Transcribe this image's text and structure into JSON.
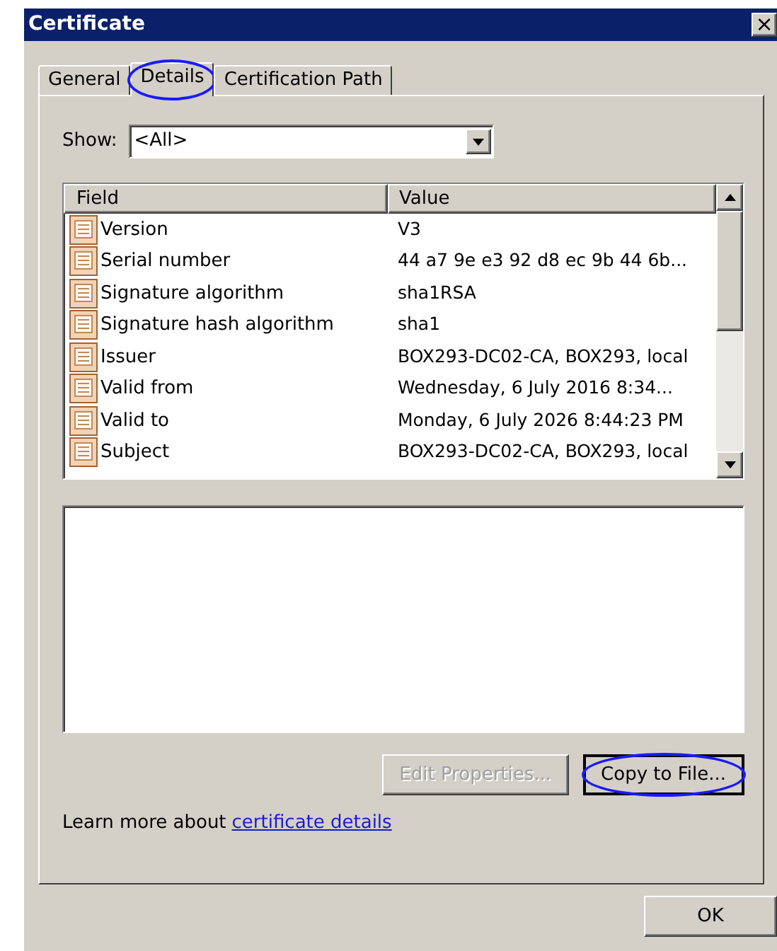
{
  "window": {
    "title": "Certificate",
    "close_label": "×"
  },
  "tabs": [
    {
      "label": "General",
      "selected": false,
      "highlighted": false
    },
    {
      "label": "Details",
      "selected": true,
      "highlighted": true
    },
    {
      "label": "Certification Path",
      "selected": false,
      "highlighted": false
    }
  ],
  "show": {
    "label": "Show:",
    "value": "<All>"
  },
  "table": {
    "columns": [
      "Field",
      "Value"
    ],
    "rows": [
      {
        "field": "Version",
        "value": "V3"
      },
      {
        "field": "Serial number",
        "value": "44 a7 9e e3 92 d8 ec 9b 44 6b..."
      },
      {
        "field": "Signature algorithm",
        "value": "sha1RSA"
      },
      {
        "field": "Signature hash algorithm",
        "value": "sha1"
      },
      {
        "field": "Issuer",
        "value": "BOX293-DC02-CA, BOX293, local"
      },
      {
        "field": "Valid from",
        "value": "Wednesday, 6 July 2016 8:34..."
      },
      {
        "field": "Valid to",
        "value": "Monday, 6 July 2026 8:44:23 PM"
      },
      {
        "field": "Subject",
        "value": "BOX293-DC02-CA, BOX293, local"
      }
    ]
  },
  "buttons": [
    {
      "label": "Edit Properties...",
      "disabled": true,
      "highlighted": false
    },
    {
      "label": "Copy to File...",
      "disabled": false,
      "highlighted": true
    }
  ],
  "learn_more": {
    "text": "Learn more about",
    "link": "certificate details"
  },
  "ok_button": {
    "label": "OK"
  }
}
